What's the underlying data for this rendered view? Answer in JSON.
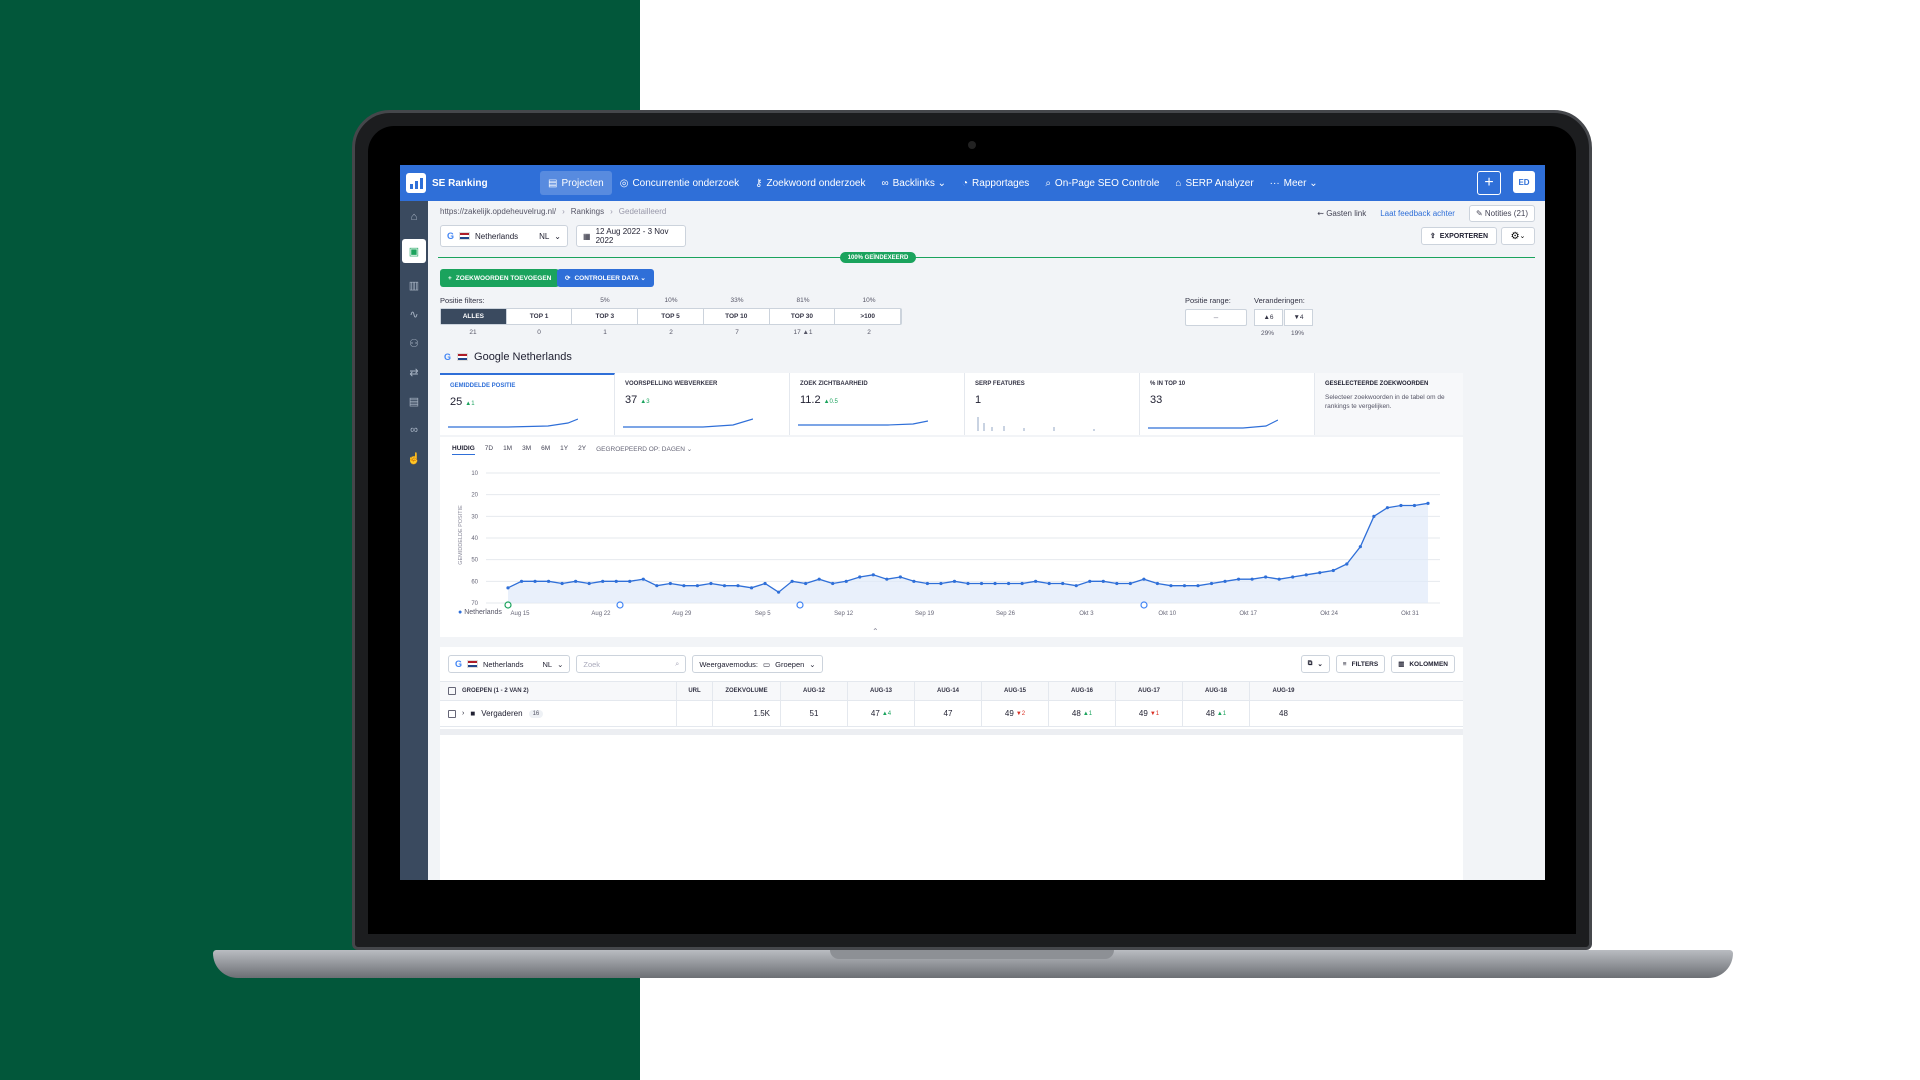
{
  "app": {
    "name": "SE Ranking",
    "avatar": "ED"
  },
  "nav": {
    "items": [
      {
        "label": "Projecten",
        "active": true
      },
      {
        "label": "Concurrentie onderzoek"
      },
      {
        "label": "Zoekwoord onderzoek"
      },
      {
        "label": "Backlinks ⌄"
      },
      {
        "label": "Rapportages"
      },
      {
        "label": "On-Page SEO Controle"
      },
      {
        "label": "SERP Analyzer"
      },
      {
        "label": "Meer ⌄"
      }
    ]
  },
  "breadcrumb": {
    "site": "https://zakelijk.opdeheuvelrug.nl/",
    "section": "Rankings",
    "current": "Gedetailleerd"
  },
  "top_links": {
    "guest": "Gasten link",
    "feedback": "Laat feedback achter",
    "notes": "Notities (21)"
  },
  "toolbar": {
    "engine_country": "Netherlands",
    "country_code": "NL",
    "date_range": "12 Aug 2022 - 3 Nov 2022",
    "export": "EXPORTEREN",
    "indexed": "100% GEÏNDEXEERD",
    "add_keywords": "ZOEKWOORDEN TOEVOEGEN",
    "check_data": "CONTROLEER DATA ⌄"
  },
  "filters": {
    "label": "Positie filters:",
    "tabs": [
      "ALLES",
      "TOP 1",
      "TOP 3",
      "TOP 5",
      "TOP 10",
      "TOP 30",
      ">100"
    ],
    "percents": [
      "",
      "",
      "5%",
      "10%",
      "33%",
      "81%",
      "10%"
    ],
    "counts": [
      "21",
      "0",
      "1",
      "2",
      "7",
      "17 ▲1",
      "2"
    ],
    "range_label": "Positie range:",
    "range_value": "–",
    "changes_label": "Veranderingen:",
    "changes_up": "▲6",
    "changes_down": "▼4",
    "changes_up_pct": "29%",
    "changes_down_pct": "19%"
  },
  "section_title": "Google Netherlands",
  "cards": [
    {
      "label": "GEMIDDELDE POSITIE",
      "value": "25",
      "delta": "▲1"
    },
    {
      "label": "VOORSPELLING WEBVERKEER",
      "value": "37",
      "delta": "▲3"
    },
    {
      "label": "ZOEK ZICHTBAARHEID",
      "value": "11.2",
      "delta": "▲0.5"
    },
    {
      "label": "SERP FEATURES",
      "value": "1",
      "delta": ""
    },
    {
      "label": "% IN TOP 10",
      "value": "33",
      "delta": ""
    }
  ],
  "side_card": {
    "label": "GESELECTEERDE ZOEKWOORDEN",
    "text": "Selecteer zoekwoorden in de tabel om de rankings te vergelijken."
  },
  "periods": [
    "HUIDIG",
    "7D",
    "1M",
    "3M",
    "6M",
    "1Y",
    "2Y"
  ],
  "grouped_by": "GEGROEPEERD OP: DAGEN ⌄",
  "chart_data": {
    "type": "line",
    "ylabel": "GEMIDDELDE POSITIE",
    "y_ticks": [
      10,
      20,
      30,
      40,
      50,
      60,
      70
    ],
    "ylim": [
      70,
      10
    ],
    "y_inverted": true,
    "x_labels": [
      "Aug 15",
      "Aug 22",
      "Aug 29",
      "Sep 5",
      "Sep 12",
      "Sep 19",
      "Sep 26",
      "Okt 3",
      "Okt 10",
      "Okt 17",
      "Okt 24",
      "Okt 31"
    ],
    "series": [
      {
        "name": "Netherlands",
        "values": [
          63,
          60,
          60,
          60,
          61,
          60,
          61,
          60,
          60,
          60,
          59,
          62,
          61,
          62,
          62,
          61,
          62,
          62,
          63,
          61,
          65,
          60,
          61,
          59,
          61,
          60,
          58,
          57,
          59,
          58,
          60,
          61,
          61,
          60,
          61,
          61,
          61,
          61,
          61,
          60,
          61,
          61,
          62,
          60,
          60,
          61,
          61,
          59,
          61,
          62,
          62,
          62,
          61,
          60,
          59,
          59,
          58,
          59,
          58,
          57,
          56,
          55,
          52,
          44,
          30,
          26,
          25,
          25,
          24
        ]
      }
    ]
  },
  "table": {
    "engine_country": "Netherlands",
    "country_code": "NL",
    "search_placeholder": "Zoek",
    "view_mode_label": "Weergavemodus:",
    "view_mode": "Groepen",
    "filters": "FILTERS",
    "columns_btn": "KOLOMMEN",
    "headers": [
      "GROEPEN (1 - 2 VAN 2)",
      "URL",
      "ZOEKVOLUME",
      "AUG-12",
      "AUG-13",
      "AUG-14",
      "AUG-15",
      "AUG-16",
      "AUG-17",
      "AUG-18",
      "AUG-19"
    ],
    "row": {
      "group": "Vergaderen",
      "count": "16",
      "volume": "1.5K",
      "values": [
        "51",
        "47",
        "47",
        "49",
        "48",
        "49",
        "48",
        "48"
      ],
      "deltas": [
        "",
        "▲4",
        "",
        "▼2",
        "▲1",
        "▼1",
        "▲1",
        ""
      ]
    }
  }
}
